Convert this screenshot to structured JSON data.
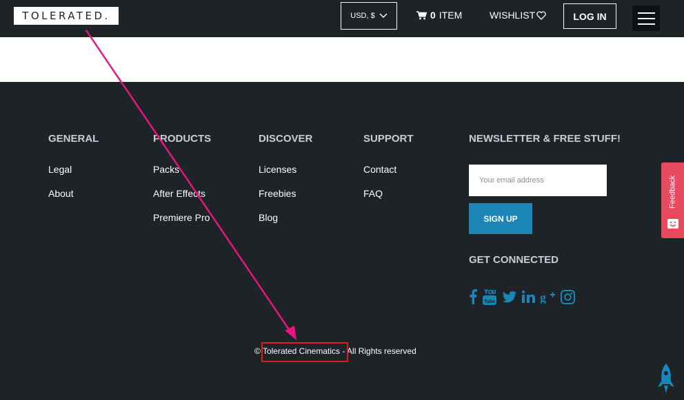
{
  "header": {
    "logo": "TOLERATED.",
    "currency": "USD, $",
    "cart_count": "0",
    "cart_label": "ITEM",
    "wishlist": "WISHLIST",
    "login": "LOG IN"
  },
  "footer": {
    "columns": [
      {
        "title": "GENERAL",
        "links": [
          "Legal",
          "About"
        ]
      },
      {
        "title": "PRODUCTS",
        "links": [
          "Packs",
          "After Effects",
          "Premiere Pro"
        ]
      },
      {
        "title": "DISCOVER",
        "links": [
          "Licenses",
          "Freebies",
          "Blog"
        ]
      },
      {
        "title": "SUPPORT",
        "links": [
          "Contact",
          "FAQ"
        ]
      }
    ],
    "newsletter": {
      "title": "NEWSLETTER & FREE STUFF!",
      "placeholder": "Your email address",
      "button": "SIGN UP"
    },
    "connect": {
      "title": "GET CONNECTED",
      "icons": [
        "facebook-icon",
        "youtube-icon",
        "twitter-icon",
        "linkedin-icon",
        "google-plus-icon",
        "instagram-icon"
      ]
    },
    "copyright": {
      "symbol": "©",
      "company": "Tolerated Cinematics",
      "suffix": "- All Rights reserved"
    }
  },
  "feedback_label": "Feedback",
  "colors": {
    "background": "#1e2327",
    "accent": "#1b86b6",
    "feedback": "#e84a5f",
    "annotation_arrow": "#e8157f",
    "annotation_box": "#e21b1b"
  }
}
